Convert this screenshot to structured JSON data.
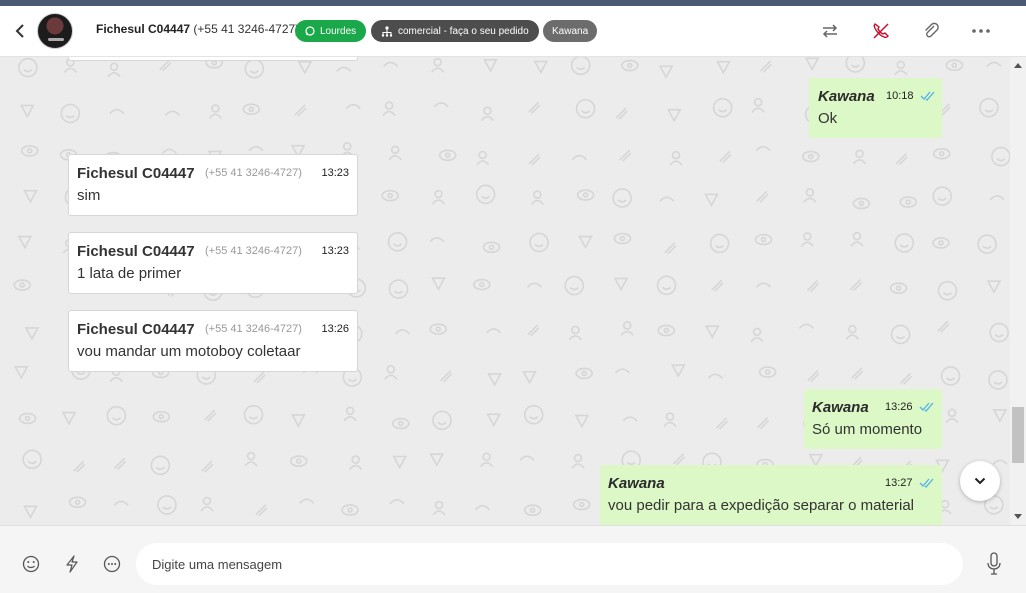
{
  "header": {
    "contact_name": "Fichesul C04447",
    "contact_phone": "(+55 41 3246-4727)",
    "tags": {
      "agent": "Lourdes",
      "queue": "comercial - faça o seu pedido",
      "user": "Kawana"
    }
  },
  "messages": {
    "out1": {
      "sender": "Kawana",
      "time": "10:18",
      "text": "Ok"
    },
    "in1": {
      "sender": "Fichesul C04447",
      "phone": "(+55 41 3246-4727)",
      "time": "13:23",
      "text": "sim"
    },
    "in2": {
      "sender": "Fichesul C04447",
      "phone": "(+55 41 3246-4727)",
      "time": "13:23",
      "text": "1 lata de primer"
    },
    "in3": {
      "sender": "Fichesul C04447",
      "phone": "(+55 41 3246-4727)",
      "time": "13:26",
      "text": "vou mandar um motoboy coletaar"
    },
    "out2": {
      "sender": "Kawana",
      "time": "13:26",
      "text": "Só um momento"
    },
    "out3": {
      "sender": "Kawana",
      "time": "13:27",
      "text": "vou pedir para a expedição separar o material"
    }
  },
  "composer": {
    "placeholder": "Digite uma mensagem"
  },
  "colors": {
    "accent_green": "#1aa84a",
    "outgoing_bubble": "#dcf8c6",
    "incoming_bubble": "#ffffff",
    "chat_background": "#ececec",
    "read_check": "#4fb3e8",
    "call_icon": "#c8102e"
  },
  "icons": {
    "back": "chevron-left-icon",
    "transfer": "swap-arrows-icon",
    "end_call": "phone-off-icon",
    "attach": "paperclip-icon",
    "more": "ellipsis-icon",
    "emoji": "smiley-icon",
    "quick_reply": "lightning-icon",
    "templates": "chat-bubble-icon",
    "mic": "microphone-icon",
    "scroll_down": "chevron-down-icon",
    "whatsapp": "whatsapp-icon",
    "queue": "org-tree-icon",
    "read_receipt": "double-check-icon"
  }
}
